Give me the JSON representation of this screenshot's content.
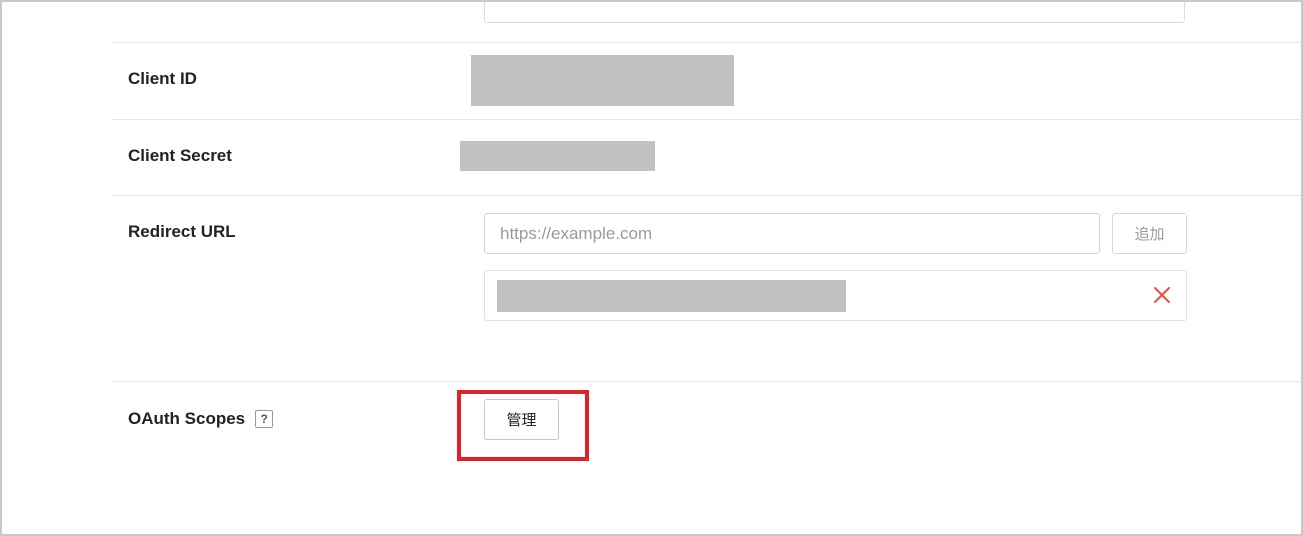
{
  "fields": {
    "client_id": {
      "label": "Client ID"
    },
    "client_secret": {
      "label": "Client Secret"
    },
    "redirect_url": {
      "label": "Redirect URL",
      "input_placeholder": "https://example.com",
      "input_value": "",
      "add_button_label": "追加",
      "remove_icon": "close-icon"
    },
    "oauth_scopes": {
      "label": "OAuth Scopes",
      "help_icon_text": "?",
      "manage_button_label": "管理"
    }
  },
  "colors": {
    "highlight": "#e2202a",
    "remove_icon": "#e8533f",
    "redacted": "#c1c1c1"
  }
}
